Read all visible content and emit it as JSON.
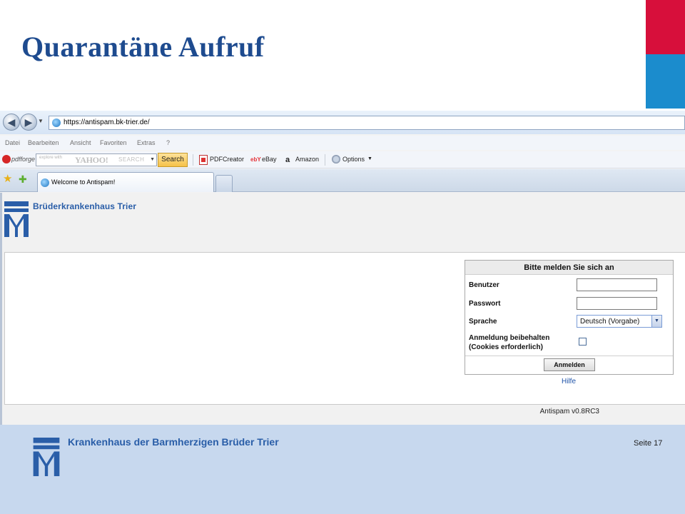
{
  "slide": {
    "title": "Quarantäne Aufruf",
    "footer_org": "Krankenhaus der Barmherzigen Brüder Trier",
    "page_label": "Seite 17"
  },
  "browser": {
    "url": "https://antispam.bk-trier.de/",
    "menu": [
      "Datei",
      "Bearbeiten",
      "Ansicht",
      "Favoriten",
      "Extras",
      "?"
    ],
    "toolbar": {
      "pdfforge_label": "pdfforge",
      "search_hint": "explore with",
      "search_brand": "YAHOO!",
      "search_word": "SEARCH",
      "search_button": "Search",
      "pdfcreator_label": "PDFCreator",
      "ebay_icon_text": "ebY",
      "ebay_label": "eBay",
      "amazon_icon_text": "a",
      "amazon_label": "Amazon",
      "options_label": "Options"
    },
    "tab_title": "Welcome to Antispam!"
  },
  "page": {
    "brand_name": "Brüderkrankenhaus Trier",
    "login": {
      "heading": "Bitte melden Sie sich an",
      "user_label": "Benutzer",
      "user_value": "",
      "password_label": "Passwort",
      "password_value": "",
      "language_label": "Sprache",
      "language_selected": "Deutsch (Vorgabe)",
      "remember_line1": "Anmeldung beibehalten",
      "remember_line2": "(Cookies erforderlich)",
      "remember_checked": false,
      "submit_label": "Anmelden"
    },
    "help_link": "Hilfe",
    "version": "Antispam v0.8RC3"
  },
  "colors": {
    "title_blue": "#1e4b8f",
    "accent_red": "#d70f3b",
    "accent_blue": "#1b8ccd",
    "footer_bg": "#c7d8ee",
    "brand_blue": "#2a5ea8"
  }
}
